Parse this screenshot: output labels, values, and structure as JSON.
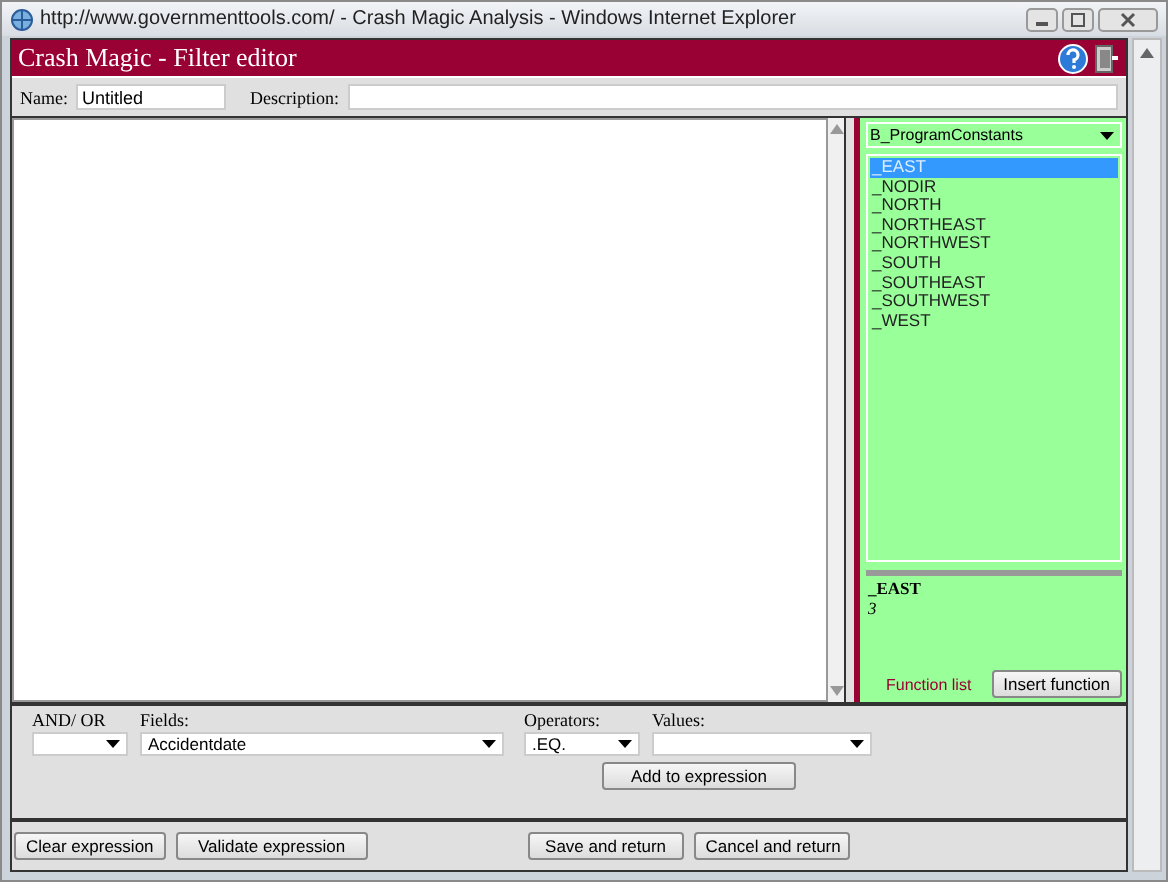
{
  "browser": {
    "title": "http://www.governmenttools.com/ - Crash Magic Analysis - Windows Internet Explorer"
  },
  "header": {
    "title": "Crash Magic - Filter editor"
  },
  "name_field": {
    "label": "Name:",
    "value": "Untitled"
  },
  "description_field": {
    "label": "Description:"
  },
  "constants": {
    "dropdown": "B_ProgramConstants",
    "items": [
      {
        "label": "_EAST",
        "selected": true
      },
      {
        "label": "_NODIR",
        "selected": false
      },
      {
        "label": "_NORTH",
        "selected": false
      },
      {
        "label": "_NORTHEAST",
        "selected": false
      },
      {
        "label": "_NORTHWEST",
        "selected": false
      },
      {
        "label": "_SOUTH",
        "selected": false
      },
      {
        "label": "_SOUTHEAST",
        "selected": false
      },
      {
        "label": "_SOUTHWEST",
        "selected": false
      },
      {
        "label": "_WEST",
        "selected": false
      }
    ],
    "detail_name": "_EAST",
    "detail_value": "3",
    "footer": "Function list",
    "insert_button": "Insert function"
  },
  "filters": [
    {
      "label": "AND/ OR"
    },
    {
      "label": "Fields:",
      "value": "Accidentdate"
    },
    {
      "label": "Operators:",
      "value": ".EQ."
    },
    {
      "label": "Values:"
    }
  ],
  "add_button": "Add to expression",
  "buttons_left": [
    "Clear expression",
    "Validate expression"
  ],
  "buttons_right": [
    "Save and return",
    "Cancel and return"
  ]
}
